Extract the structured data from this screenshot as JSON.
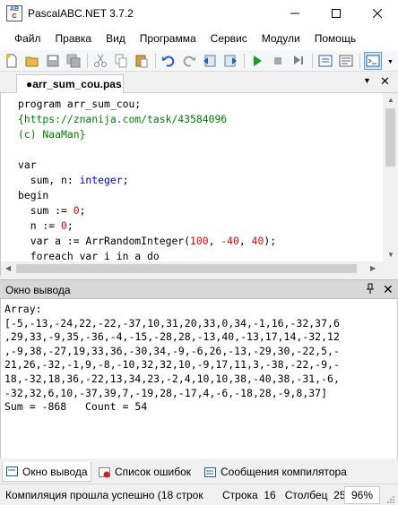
{
  "window": {
    "title": "PascalABC.NET 3.7.2",
    "minimize": "—",
    "maximize": "☐",
    "close": "✕"
  },
  "menu": [
    "Файл",
    "Правка",
    "Вид",
    "Программа",
    "Сервис",
    "Модули",
    "Помощь"
  ],
  "toolbar": {
    "icons": [
      "new-file",
      "open",
      "save",
      "save-all",
      "cut",
      "copy",
      "paste",
      "undo",
      "redo",
      "navigate-back",
      "navigate-forward",
      "run",
      "stop",
      "debug",
      "compile-options",
      "properties",
      "output-window"
    ]
  },
  "editor_tab": {
    "label": "●arr_sum_cou.pas",
    "menu": "▼",
    "close": "✕"
  },
  "code": {
    "line1": "program arr_sum_cou;",
    "line2": "{https://znanija.com/task/43584096",
    "line3": "(c) NaaMan}",
    "line4": "",
    "line5": "var",
    "line6a": "  sum, n: ",
    "line6b": "integer",
    "line6c": ";",
    "line7": "begin",
    "line8a": "  sum := ",
    "line8b": "0",
    "line8c": ";",
    "line9a": "  n := ",
    "line9b": "0",
    "line9c": ";",
    "line10a": "  var a := ArrRandomInteger(",
    "line10b": "100",
    "line10c": ", ",
    "line10d": "-40",
    "line10e": ", ",
    "line10f": "40",
    "line10g": ");",
    "line11": "  foreach var i in a do"
  },
  "output_panel": {
    "title": "Окно вывода",
    "pin": "⊥",
    "close": "✕",
    "lines": [
      "Array:",
      "[-5,-13,-24,22,-22,-37,10,31,20,33,0,34,-1,16,-32,37,6",
      ",29,33,-9,35,-36,-4,-15,-28,28,-13,40,-13,17,14,-32,12",
      ",-9,38,-27,19,33,36,-30,34,-9,-6,26,-13,-29,30,-22,5,-",
      "21,26,-32,-1,9,-8,-10,32,32,10,-9,17,11,3,-38,-22,-9,-",
      "18,-32,18,36,-22,13,34,23,-2,4,10,10,38,-40,38,-31,-6,",
      "-32,32,6,10,-37,39,7,-19,28,-17,4,-6,-18,28,-9,8,37]",
      "Sum = -868   Count = 54"
    ]
  },
  "bottom_tabs": [
    {
      "label": "Окно вывода",
      "active": true
    },
    {
      "label": "Список ошибок",
      "active": false
    },
    {
      "label": "Сообщения компилятора",
      "active": false
    }
  ],
  "status": {
    "message": "Компиляция прошла успешно (18 строк",
    "line_label": "Строка",
    "line_value": "16",
    "col_label": "Столбец",
    "col_value": "25",
    "zoom": "96%"
  },
  "colors": {
    "comment": "#008000",
    "type": "#0000cd",
    "number": "#e00000",
    "panel_header": "#d7d7d7"
  }
}
